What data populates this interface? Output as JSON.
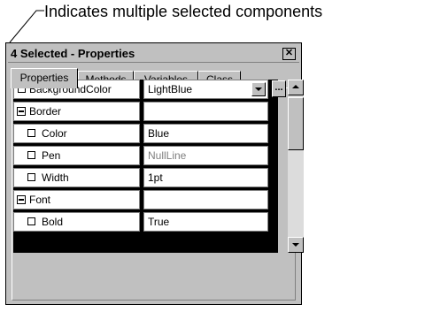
{
  "callout": {
    "text": "Indicates multiple selected components"
  },
  "window": {
    "title": "4 Selected - Properties",
    "close_glyph": "✕"
  },
  "tabs": [
    {
      "label": "Properties",
      "active": true
    },
    {
      "label": "Methods"
    },
    {
      "label": "Variables"
    },
    {
      "label": "Class"
    }
  ],
  "toolbar": {
    "buttons": [
      {
        "icon": "line-style-icon"
      },
      {
        "icon": "align-left-icon",
        "pressed": true
      },
      {
        "icon": "align-center-icon"
      },
      {
        "icon": "align-right-icon"
      },
      {
        "icon": "grid-icon"
      },
      {
        "icon": "tools-icon"
      },
      {
        "icon": "select-region-icon"
      },
      {
        "icon": "edit-checklist-icon"
      },
      {
        "icon": "delete-icon"
      }
    ]
  },
  "properties": [
    {
      "name": "BackgroundColor",
      "value": "LightBlue",
      "level": 0,
      "kind": "checkbox",
      "dropdown": true
    },
    {
      "name": "Border",
      "value": "",
      "level": 0,
      "kind": "expander"
    },
    {
      "name": "Color",
      "value": "Blue",
      "level": 1,
      "kind": "checkbox"
    },
    {
      "name": "Pen",
      "value": "NullLine",
      "level": 1,
      "kind": "checkbox",
      "dim": true
    },
    {
      "name": "Width",
      "value": "1pt",
      "level": 1,
      "kind": "checkbox"
    },
    {
      "name": "Font",
      "value": "",
      "level": 0,
      "kind": "expander"
    },
    {
      "name": "Bold",
      "value": "True",
      "level": 1,
      "kind": "checkbox"
    }
  ],
  "ellipsis": {
    "label": "..."
  }
}
